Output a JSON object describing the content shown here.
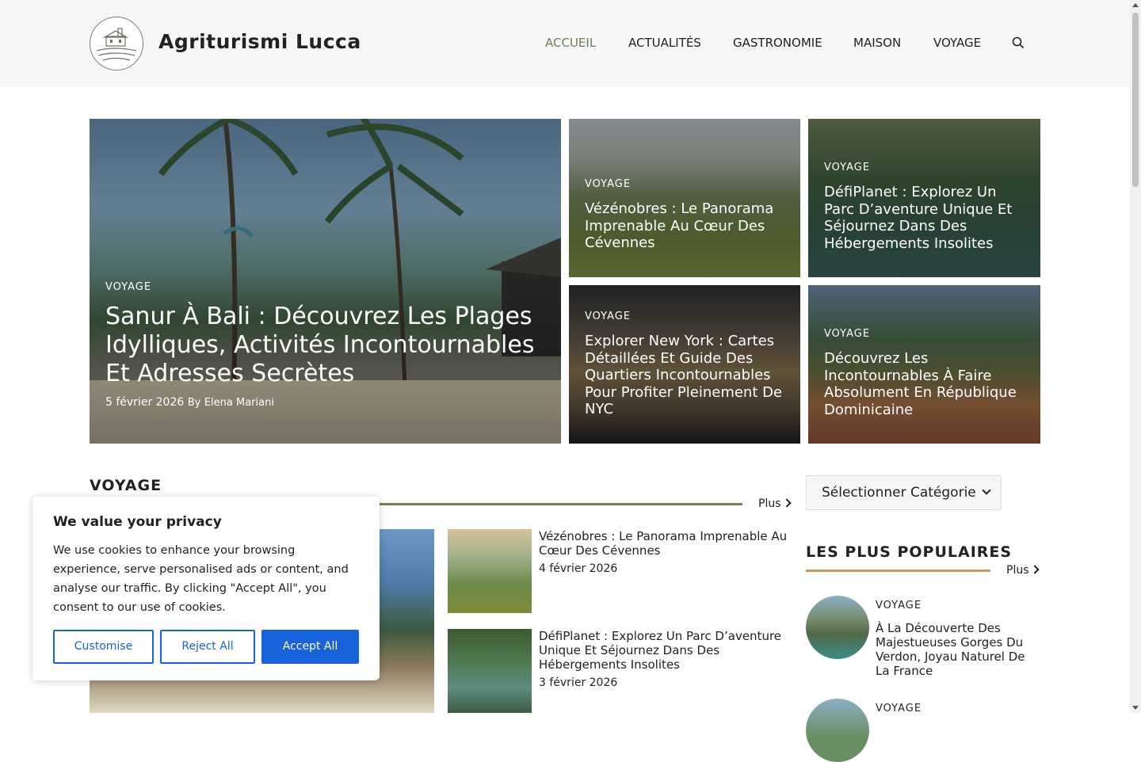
{
  "site": {
    "title": "Agriturismi Lucca"
  },
  "nav": {
    "items": [
      {
        "label": "ACCUEIL",
        "active": true
      },
      {
        "label": "ACTUALITÉS",
        "active": false
      },
      {
        "label": "GASTRONOMIE",
        "active": false
      },
      {
        "label": "MAISON",
        "active": false
      },
      {
        "label": "VOYAGE",
        "active": false
      }
    ],
    "search_icon": "search-icon"
  },
  "hero": {
    "main": {
      "category": "VOYAGE",
      "title": "Sanur À Bali : Découvrez Les Plages Idylliques, Activités Incontournables Et Adresses Secrètes",
      "date": "5 février 2026",
      "by": "By",
      "author": "Elena Mariani"
    },
    "cards": [
      {
        "category": "VOYAGE",
        "title": "Vézénobres : Le Panorama Imprenable Au Cœur Des Cévennes"
      },
      {
        "category": "VOYAGE",
        "title": "DéfiPlanet : Explorez Un Parc D’aventure Unique Et Séjournez Dans Des Hébergements Insolites"
      },
      {
        "category": "VOYAGE",
        "title": "Explorer New York : Cartes Détaillées Et Guide Des Quartiers Incontournables Pour Profiter Pleinement De NYC"
      },
      {
        "category": "VOYAGE",
        "title": "Découvrez Les Incontournables À Faire Absolument En République Dominicaine"
      }
    ]
  },
  "voyage_section": {
    "title": "VOYAGE",
    "more": "Plus",
    "posts": [
      {
        "title": "Vézénobres : Le Panorama Imprenable Au Cœur Des Cévennes",
        "date": "4 février 2026"
      },
      {
        "title": "DéfiPlanet : Explorez Un Parc D’aventure Unique Et Séjournez Dans Des Hébergements Insolites",
        "date": "3 février 2026"
      }
    ]
  },
  "sidebar": {
    "category_select": "Sélectionner Catégorie",
    "popular_title": "LES PLUS POPULAIRES",
    "more": "Plus",
    "popular": [
      {
        "category": "VOYAGE",
        "title": "À La Découverte Des Majestueuses Gorges Du Verdon, Joyau Naturel De La France"
      },
      {
        "category": "VOYAGE",
        "title": ""
      }
    ]
  },
  "cookie": {
    "title": "We value your privacy",
    "text": "We use cookies to enhance your browsing experience, serve personalised ads or content, and analyse our traffic. By clicking \"Accept All\", you consent to our use of cookies.",
    "customise": "Customise",
    "reject": "Reject All",
    "accept": "Accept All"
  },
  "colors": {
    "accent": "#727d54",
    "popular_accent": "#c49a5a",
    "cookie_blue": "#1863dc"
  }
}
